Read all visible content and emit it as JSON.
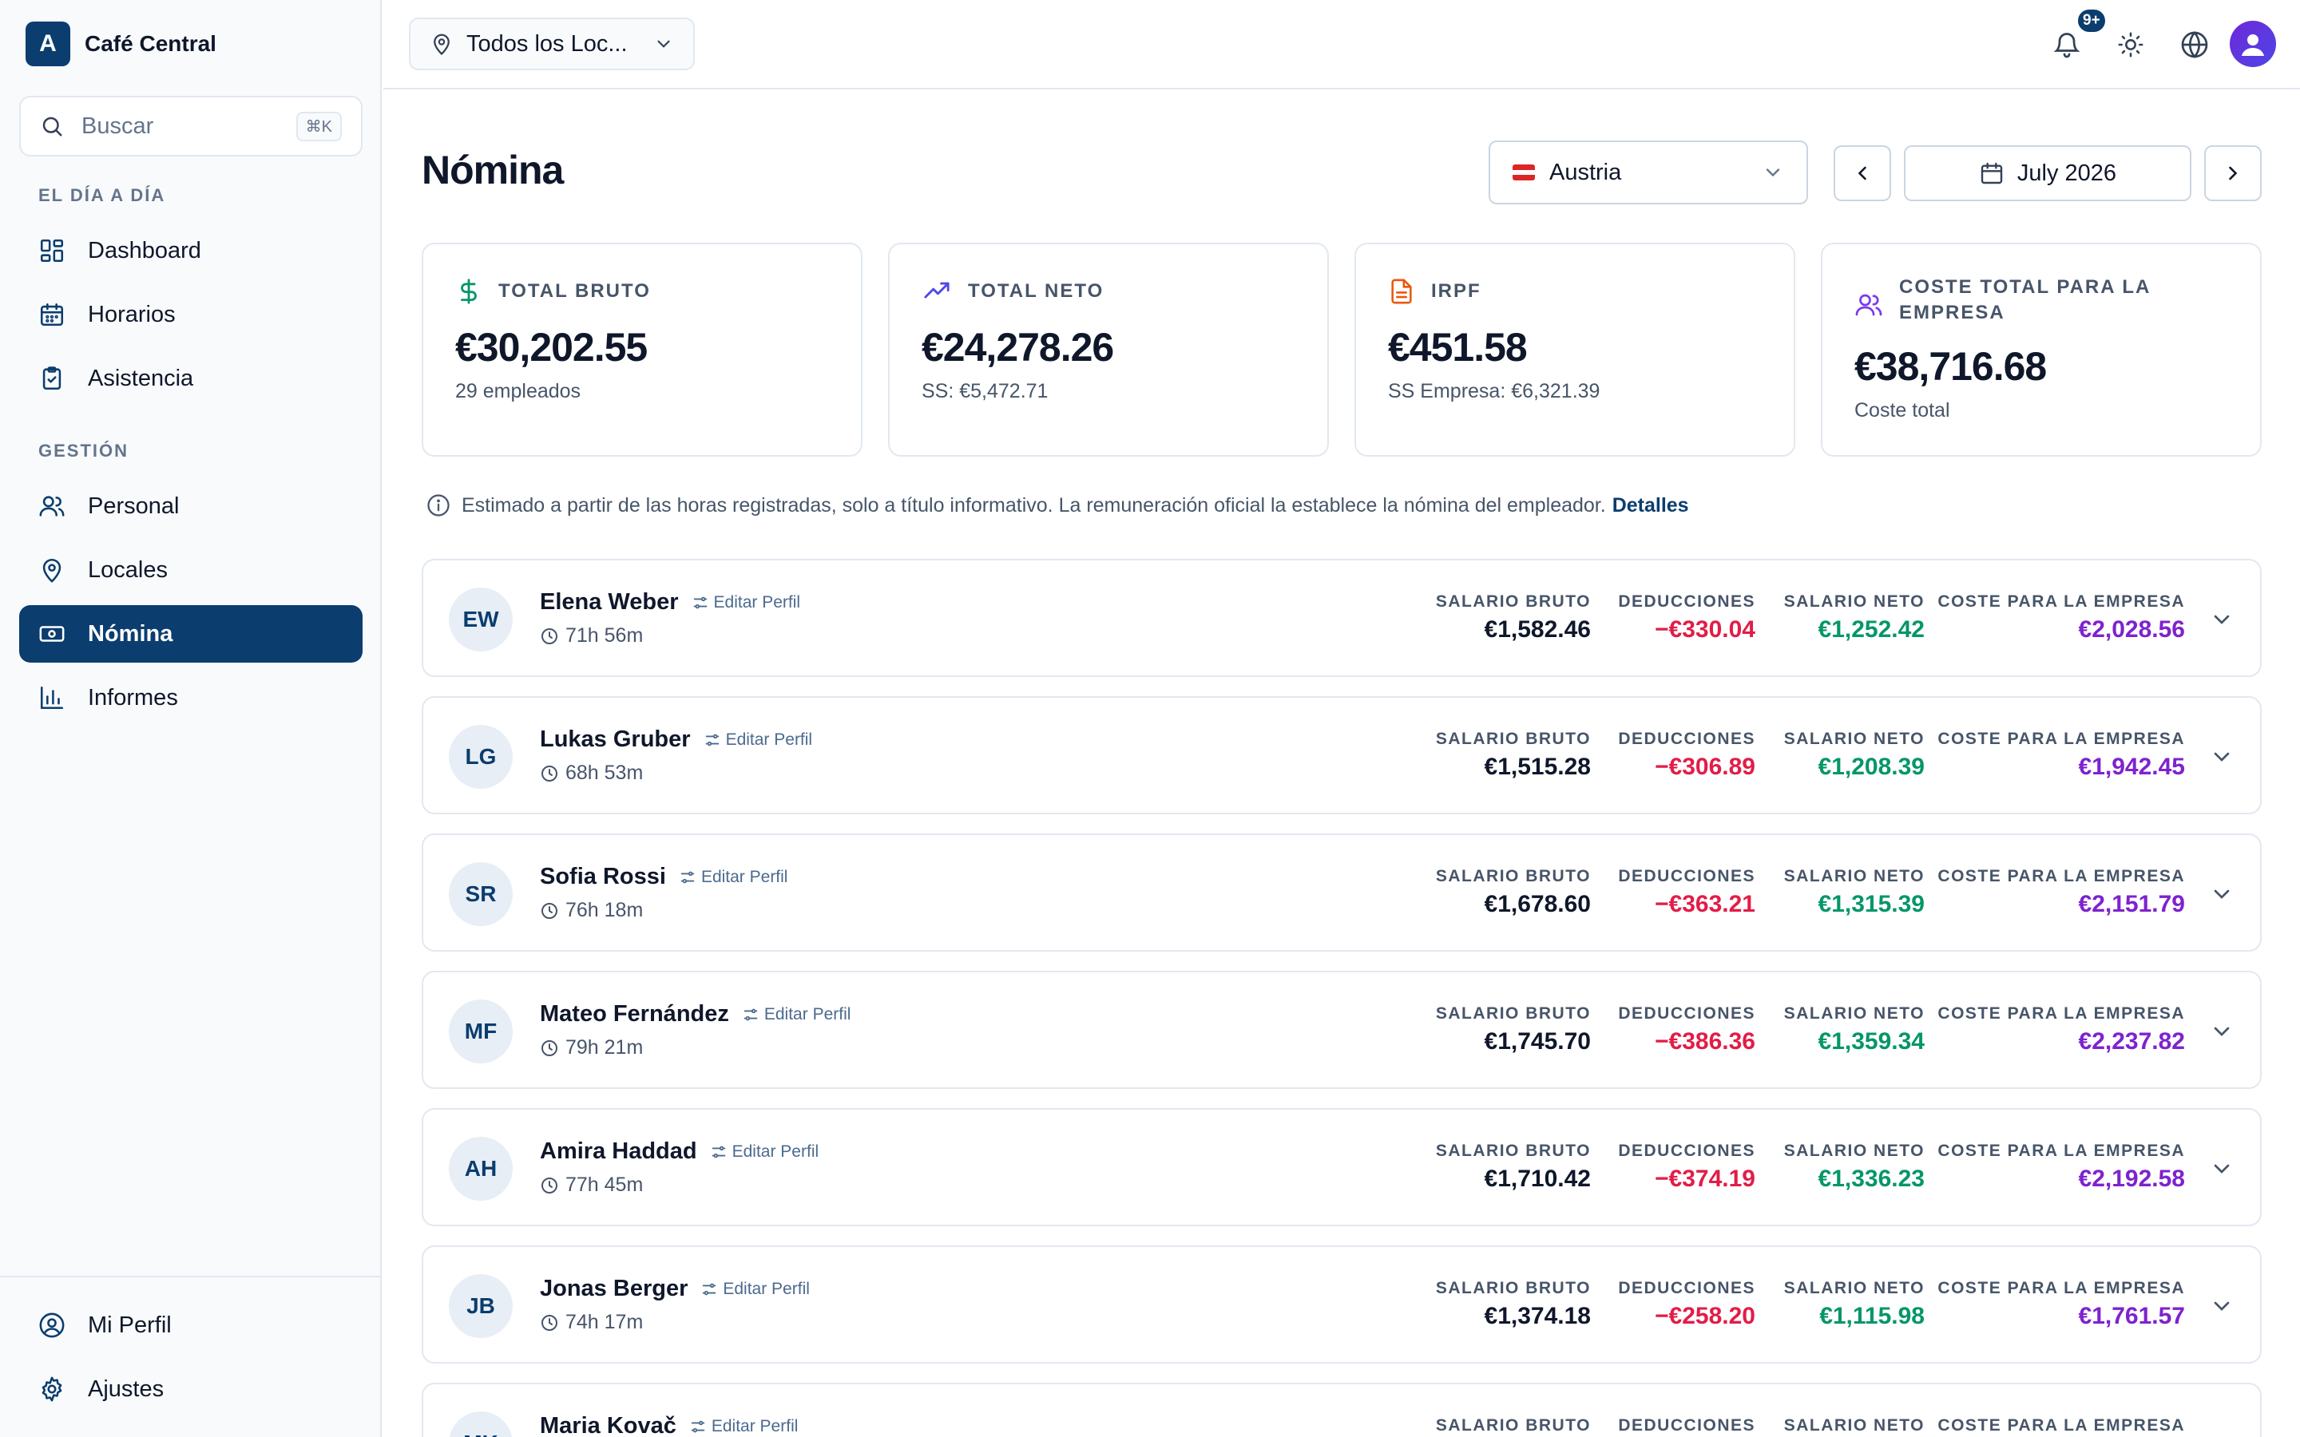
{
  "brand": {
    "logo_letter": "A",
    "name": "Café Central"
  },
  "search": {
    "placeholder": "Buscar",
    "shortcut": "⌘K"
  },
  "sidebar": {
    "sections": [
      {
        "label": "EL DÍA A DÍA"
      },
      {
        "label": "GESTIÓN"
      }
    ],
    "items": [
      {
        "label": "Dashboard",
        "icon": "dashboard-icon"
      },
      {
        "label": "Horarios",
        "icon": "calendar-icon"
      },
      {
        "label": "Asistencia",
        "icon": "clipboard-check-icon"
      },
      {
        "label": "Personal",
        "icon": "users-icon"
      },
      {
        "label": "Locales",
        "icon": "map-pin-icon"
      },
      {
        "label": "Nómina",
        "icon": "banknote-icon",
        "active": true
      },
      {
        "label": "Informes",
        "icon": "bar-chart-icon"
      }
    ],
    "footer_items": [
      {
        "label": "Mi Perfil",
        "icon": "user-circle-icon"
      },
      {
        "label": "Ajustes",
        "icon": "gear-icon"
      }
    ]
  },
  "topbar": {
    "location_select": "Todos los Loc...",
    "notification_badge": "9+"
  },
  "page": {
    "title": "Nómina",
    "country": "Austria",
    "month": "July 2026"
  },
  "stats": [
    {
      "title": "TOTAL BRUTO",
      "value": "€30,202.55",
      "sub": "29 empleados",
      "color": "#059669"
    },
    {
      "title": "TOTAL NETO",
      "value": "€24,278.26",
      "sub": "SS: €5,472.71",
      "color": "#4f46e5"
    },
    {
      "title": "IRPF",
      "value": "€451.58",
      "sub": "SS Empresa: €6,321.39",
      "color": "#ea580c"
    },
    {
      "title_line1": "COSTE TOTAL PARA LA",
      "title_line2": "EMPRESA",
      "value": "€38,716.68",
      "sub": "Coste total",
      "color": "#7c3aed"
    }
  ],
  "info": {
    "text": "Estimado a partir de las horas registradas, solo a título informativo. La remuneración oficial la establece la nómina del empleador.",
    "link": "Detalles"
  },
  "columns": {
    "gross": "SALARIO BRUTO",
    "deductions": "DEDUCCIONES",
    "net": "SALARIO NETO",
    "cost": "COSTE PARA LA EMPRESA"
  },
  "edit_label": "Editar Perfil",
  "employees": [
    {
      "initials": "EW",
      "name": "Elena Weber",
      "hours": "71h 56m",
      "gross": "€1,582.46",
      "deductions": "−€330.04",
      "net": "€1,252.42",
      "cost": "€2,028.56"
    },
    {
      "initials": "LG",
      "name": "Lukas Gruber",
      "hours": "68h 53m",
      "gross": "€1,515.28",
      "deductions": "−€306.89",
      "net": "€1,208.39",
      "cost": "€1,942.45"
    },
    {
      "initials": "SR",
      "name": "Sofia Rossi",
      "hours": "76h 18m",
      "gross": "€1,678.60",
      "deductions": "−€363.21",
      "net": "€1,315.39",
      "cost": "€2,151.79"
    },
    {
      "initials": "MF",
      "name": "Mateo Fernández",
      "hours": "79h 21m",
      "gross": "€1,745.70",
      "deductions": "−€386.36",
      "net": "€1,359.34",
      "cost": "€2,237.82"
    },
    {
      "initials": "AH",
      "name": "Amira Haddad",
      "hours": "77h 45m",
      "gross": "€1,710.42",
      "deductions": "−€374.19",
      "net": "€1,336.23",
      "cost": "€2,192.58"
    },
    {
      "initials": "JB",
      "name": "Jonas Berger",
      "hours": "74h 17m",
      "gross": "€1,374.18",
      "deductions": "−€258.20",
      "net": "€1,115.98",
      "cost": "€1,761.57"
    },
    {
      "initials": "MK",
      "name": "Maria Kovač",
      "hours": "",
      "gross": "",
      "deductions": "",
      "net": "",
      "cost": ""
    }
  ],
  "colors": {
    "brand": "#0b3d6e",
    "deductions": "#e11d48",
    "net": "#059669",
    "cost": "#7e22ce"
  }
}
